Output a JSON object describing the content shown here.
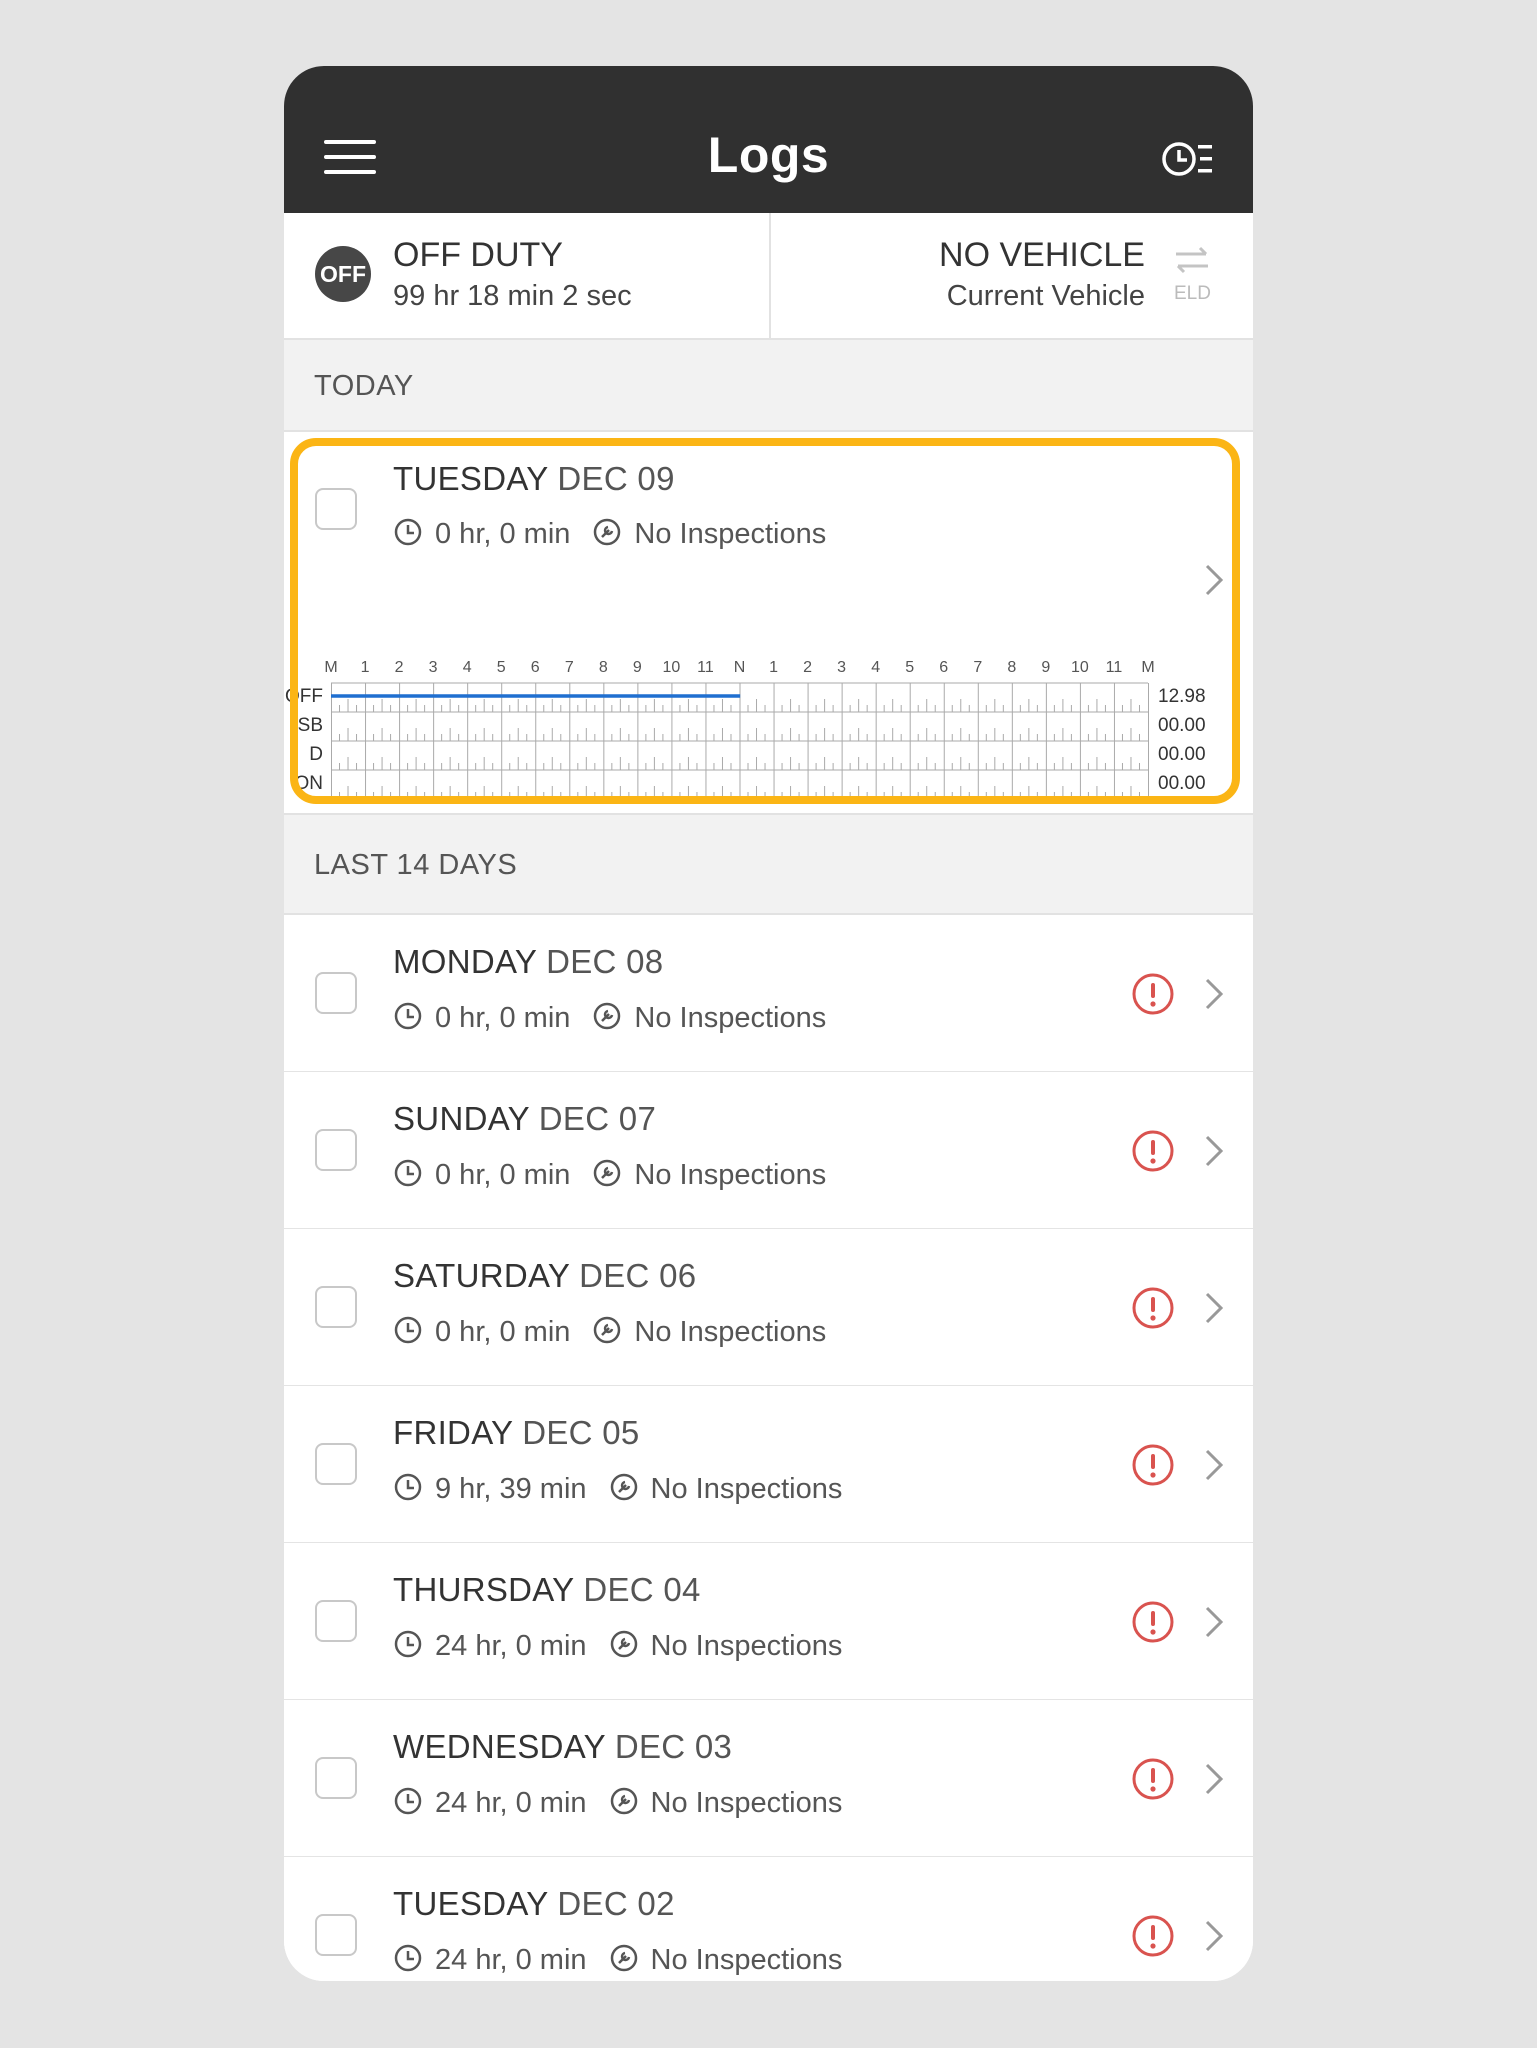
{
  "header": {
    "title": "Logs",
    "menu_icon": "hamburger-icon",
    "history_icon": "clock-list-icon"
  },
  "status": {
    "duty_badge": "OFF",
    "duty_status": "OFF DUTY",
    "duty_time": "99 hr 18 min 2 sec",
    "vehicle": "NO VEHICLE",
    "vehicle_sub": "Current Vehicle",
    "eld_label": "ELD"
  },
  "sections": {
    "today": "TODAY",
    "last14": "LAST 14 DAYS"
  },
  "today": {
    "day": "TUESDAY",
    "date": "DEC 09",
    "duration": "0 hr, 0 min",
    "inspections": "No Inspections",
    "graph": {
      "hour_labels": [
        "M",
        "1",
        "2",
        "3",
        "4",
        "5",
        "6",
        "7",
        "8",
        "9",
        "10",
        "11",
        "N",
        "1",
        "2",
        "3",
        "4",
        "5",
        "6",
        "7",
        "8",
        "9",
        "10",
        "11",
        "M"
      ],
      "rows": [
        {
          "label": "OFF",
          "total": "12.98"
        },
        {
          "label": "SB",
          "total": "00.00"
        },
        {
          "label": "D",
          "total": "00.00"
        },
        {
          "label": "ON",
          "total": "00.00"
        }
      ],
      "off_duty_hours": [
        0,
        12.98
      ],
      "line_color": "#1f6fd0"
    }
  },
  "days": [
    {
      "day": "MONDAY",
      "date": "DEC 08",
      "duration": "0 hr, 0 min",
      "inspections": "No Inspections",
      "alert": true
    },
    {
      "day": "SUNDAY",
      "date": "DEC 07",
      "duration": "0 hr, 0 min",
      "inspections": "No Inspections",
      "alert": true
    },
    {
      "day": "SATURDAY",
      "date": "DEC 06",
      "duration": "0 hr, 0 min",
      "inspections": "No Inspections",
      "alert": true
    },
    {
      "day": "FRIDAY",
      "date": "DEC 05",
      "duration": "9 hr, 39 min",
      "inspections": "No Inspections",
      "alert": true
    },
    {
      "day": "THURSDAY",
      "date": "DEC 04",
      "duration": "24 hr, 0 min",
      "inspections": "No Inspections",
      "alert": true
    },
    {
      "day": "WEDNESDAY",
      "date": "DEC 03",
      "duration": "24 hr, 0 min",
      "inspections": "No Inspections",
      "alert": true
    },
    {
      "day": "TUESDAY",
      "date": "DEC 02",
      "duration": "24 hr, 0 min",
      "inspections": "No Inspections",
      "alert": true
    }
  ],
  "colors": {
    "header_bg": "#303030",
    "highlight": "#fbb515",
    "alert": "#d9534f",
    "section_bg": "#f2f2f2"
  }
}
